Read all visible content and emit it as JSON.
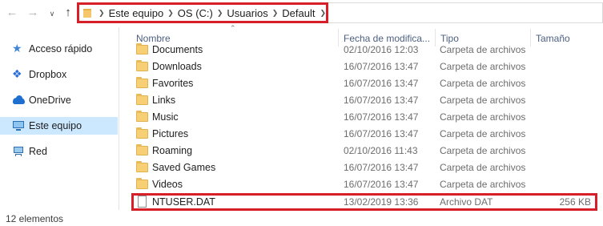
{
  "address": {
    "crumbs": [
      "Este equipo",
      "OS (C:)",
      "Usuarios",
      "Default"
    ]
  },
  "navpane": {
    "items": [
      {
        "label": "Acceso rápido",
        "icon": "quick-access-star-icon"
      },
      {
        "label": "Dropbox",
        "icon": "dropbox-icon"
      },
      {
        "label": "OneDrive",
        "icon": "onedrive-cloud-icon"
      },
      {
        "label": "Este equipo",
        "icon": "this-pc-icon",
        "selected": true
      },
      {
        "label": "Red",
        "icon": "network-icon"
      }
    ]
  },
  "list": {
    "columns": {
      "name": "Nombre",
      "date": "Fecha de modifica...",
      "type": "Tipo",
      "size": "Tamaño"
    },
    "rows": [
      {
        "name": "Documents",
        "date": "02/10/2016 12:03",
        "type": "Carpeta de archivos",
        "size": "",
        "kind": "folder"
      },
      {
        "name": "Downloads",
        "date": "16/07/2016 13:47",
        "type": "Carpeta de archivos",
        "size": "",
        "kind": "folder"
      },
      {
        "name": "Favorites",
        "date": "16/07/2016 13:47",
        "type": "Carpeta de archivos",
        "size": "",
        "kind": "folder"
      },
      {
        "name": "Links",
        "date": "16/07/2016 13:47",
        "type": "Carpeta de archivos",
        "size": "",
        "kind": "folder"
      },
      {
        "name": "Music",
        "date": "16/07/2016 13:47",
        "type": "Carpeta de archivos",
        "size": "",
        "kind": "folder"
      },
      {
        "name": "Pictures",
        "date": "16/07/2016 13:47",
        "type": "Carpeta de archivos",
        "size": "",
        "kind": "folder"
      },
      {
        "name": "Roaming",
        "date": "02/10/2016 11:43",
        "type": "Carpeta de archivos",
        "size": "",
        "kind": "folder"
      },
      {
        "name": "Saved Games",
        "date": "16/07/2016 13:47",
        "type": "Carpeta de archivos",
        "size": "",
        "kind": "folder"
      },
      {
        "name": "Videos",
        "date": "16/07/2016 13:47",
        "type": "Carpeta de archivos",
        "size": "",
        "kind": "folder"
      },
      {
        "name": "NTUSER.DAT",
        "date": "13/02/2019 13:36",
        "type": "Archivo DAT",
        "size": "256 KB",
        "kind": "file"
      }
    ]
  },
  "status": {
    "count": "12 elementos"
  },
  "colors": {
    "highlight_border": "#d61f28",
    "selected_nav": "#cce8ff",
    "header_text": "#4d6082"
  }
}
